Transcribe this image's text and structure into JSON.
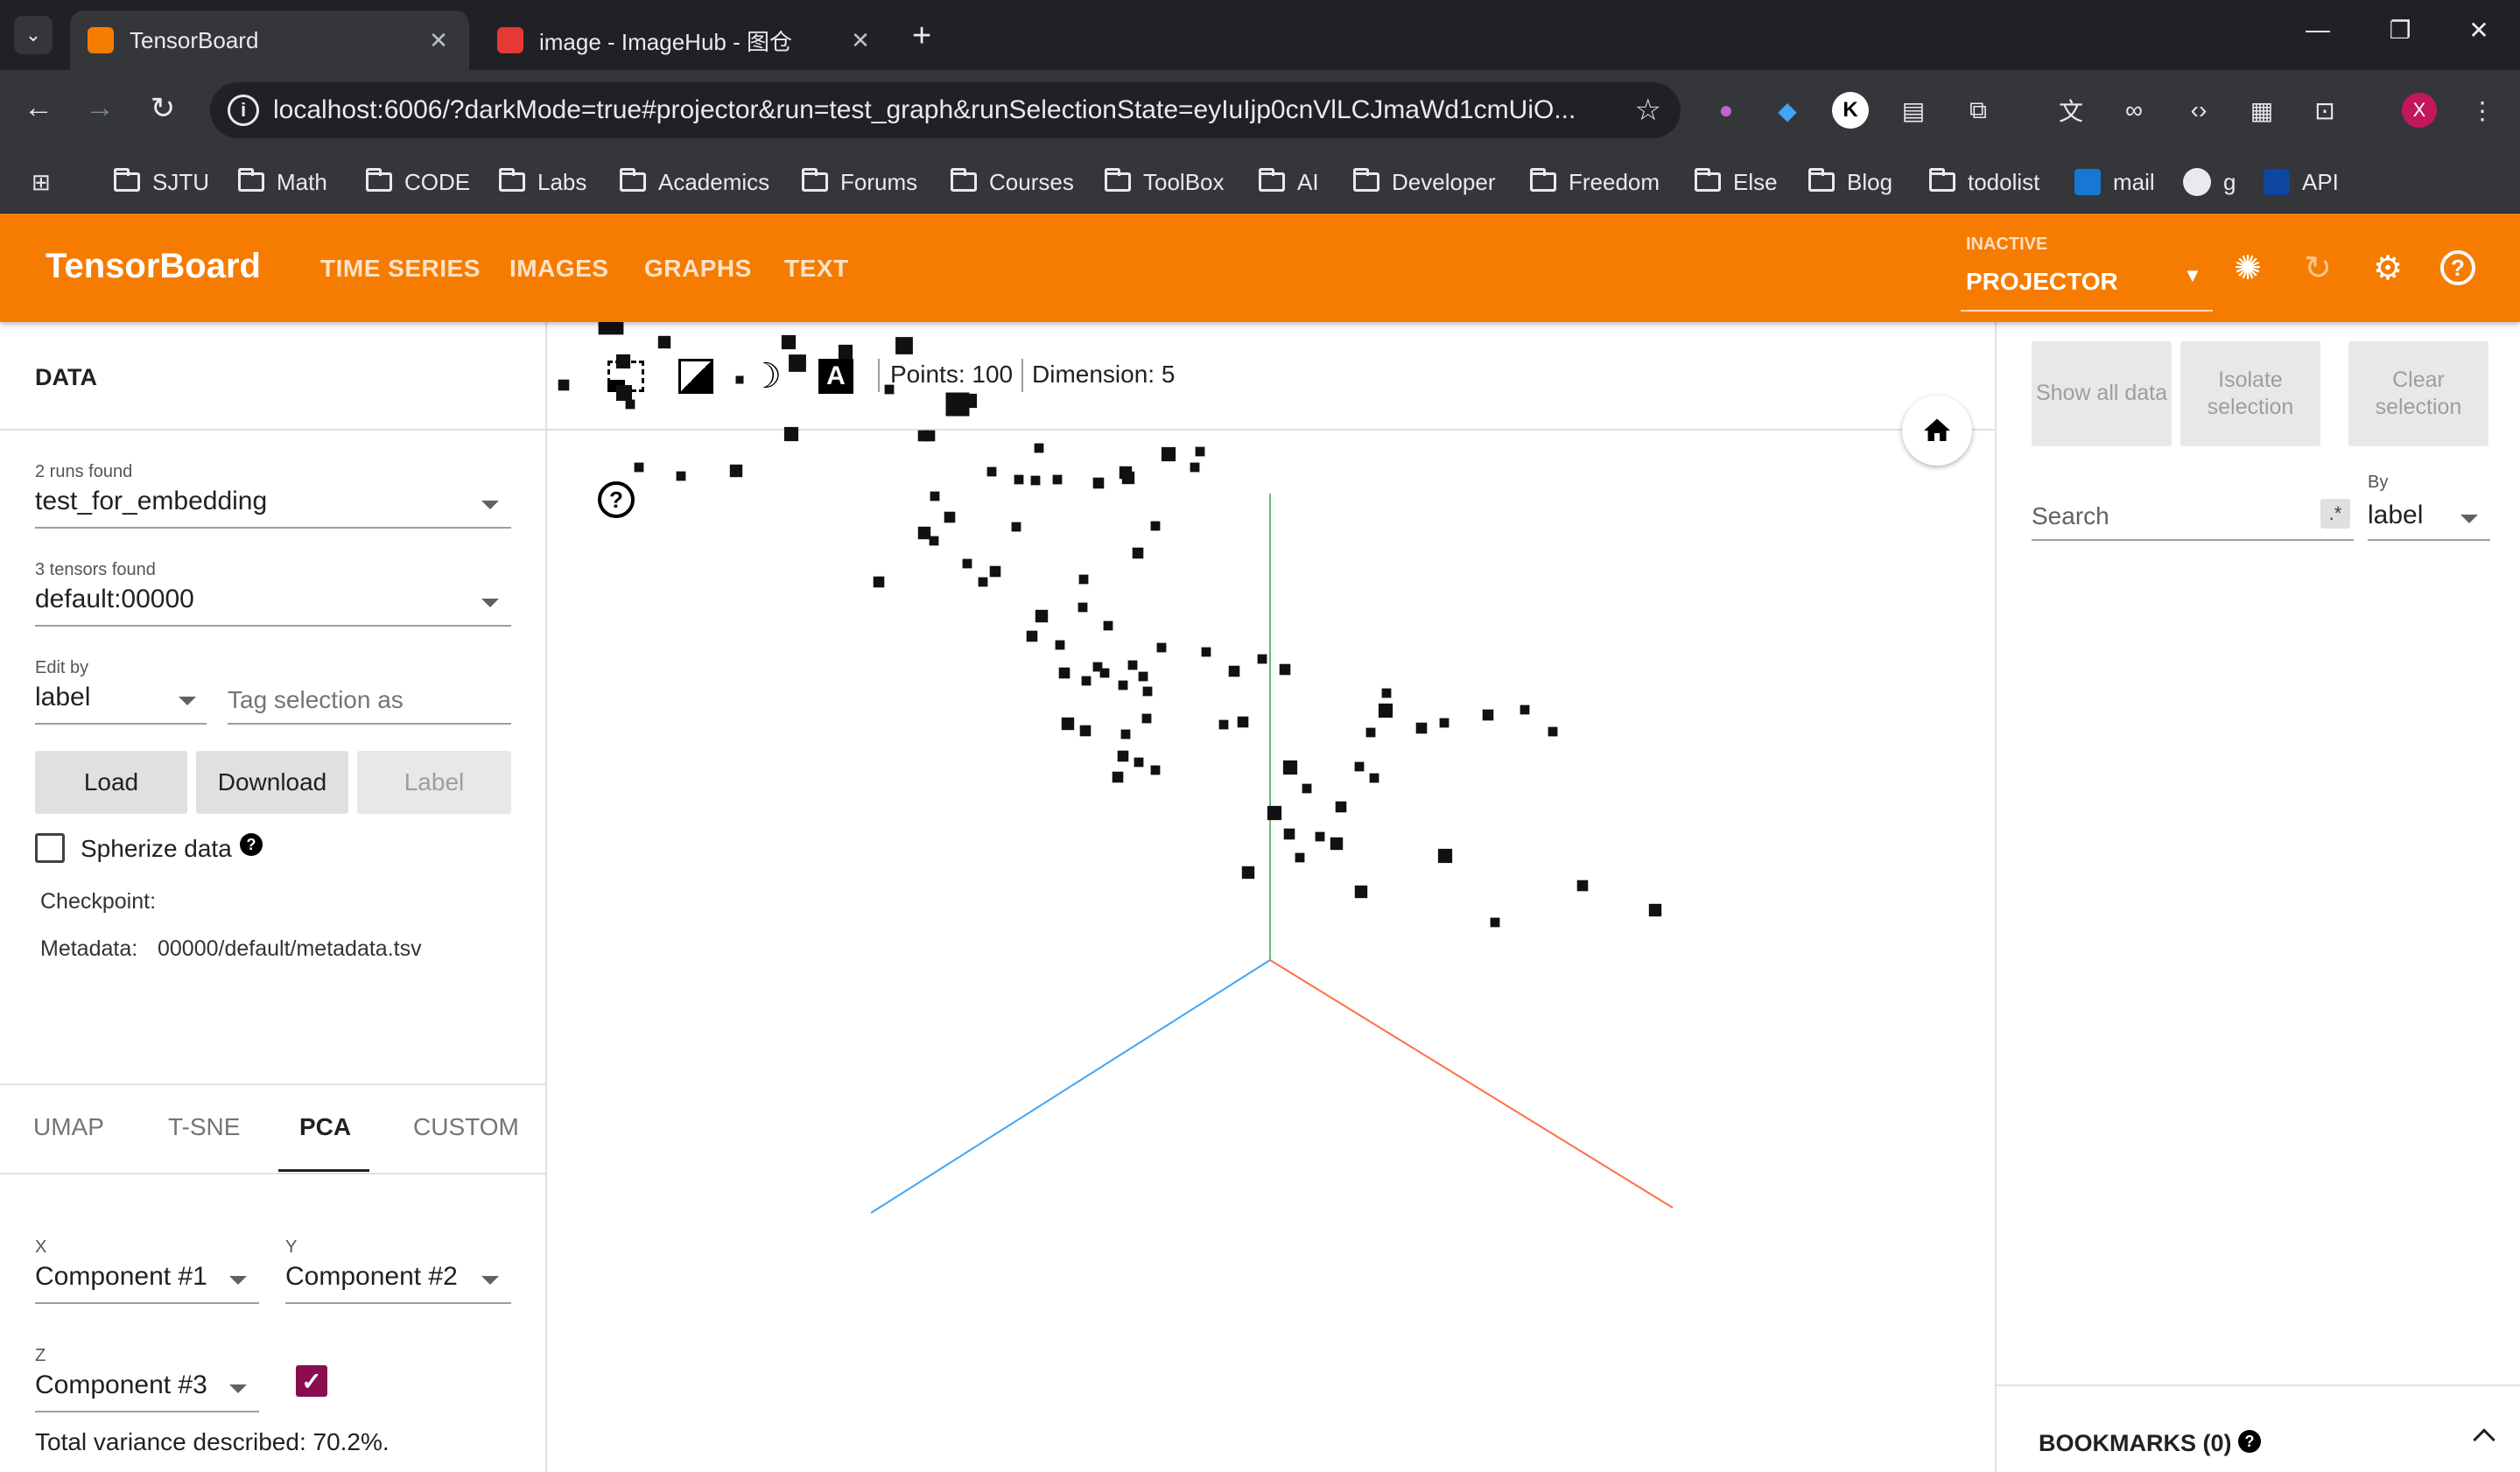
{
  "browser": {
    "tabs": [
      {
        "title": "TensorBoard",
        "active": true
      },
      {
        "title": "image - ImageHub - 图仓",
        "active": false
      }
    ],
    "url": "localhost:6006/?darkMode=true#projector&run=test_graph&runSelectionState=eyIuIjp0cnVlLCJmaWd1cmUiO...",
    "bookmarks": [
      "SJTU",
      "Math",
      "CODE",
      "Labs",
      "Academics",
      "Forums",
      "Courses",
      "ToolBox",
      "AI",
      "Developer",
      "Freedom",
      "Else",
      "Blog",
      "todolist",
      "mail",
      "g",
      "API"
    ],
    "profile_initial": "X",
    "accent": "#c2185b"
  },
  "app": {
    "title": "TensorBoard",
    "nav": [
      "TIME SERIES",
      "IMAGES",
      "GRAPHS",
      "TEXT"
    ],
    "plugin_status": "INACTIVE",
    "plugin_selected": "PROJECTOR",
    "header_color": "#f57c00"
  },
  "left": {
    "section_title": "DATA",
    "runs_label": "2 runs found",
    "run_value": "test_for_embedding",
    "tensors_label": "3 tensors found",
    "tensor_value": "default:00000",
    "edit_by_label": "Edit by",
    "edit_by_value": "label",
    "tag_placeholder": "Tag selection as",
    "buttons": {
      "load": "Load",
      "download": "Download",
      "label": "Label"
    },
    "spherize_label": "Spherize data",
    "checkpoint_label": "Checkpoint:",
    "metadata_label": "Metadata:",
    "metadata_value": "00000/default/metadata.tsv",
    "algo_tabs": [
      "UMAP",
      "T-SNE",
      "PCA",
      "CUSTOM"
    ],
    "algo_active": "PCA",
    "x_label": "X",
    "x_value": "Component #1",
    "y_label": "Y",
    "y_value": "Component #2",
    "z_label": "Z",
    "z_value": "Component #3",
    "z_enabled": true,
    "variance_text": "Total variance described: 70.2%."
  },
  "center": {
    "points_text": "Points: 100",
    "dimension_text": "Dimension: 5",
    "help_glyph": "?",
    "axis_colors": {
      "x": "#ff7043",
      "y": "#66bb6a",
      "z": "#42a5f5"
    }
  },
  "right": {
    "buttons": [
      "Show all data",
      "Isolate selection",
      "Clear selection"
    ],
    "search_placeholder": "Search",
    "regex_glyph": ".*",
    "by_label": "By",
    "by_value": "label",
    "bookmarks_title": "BOOKMARKS (0)"
  }
}
